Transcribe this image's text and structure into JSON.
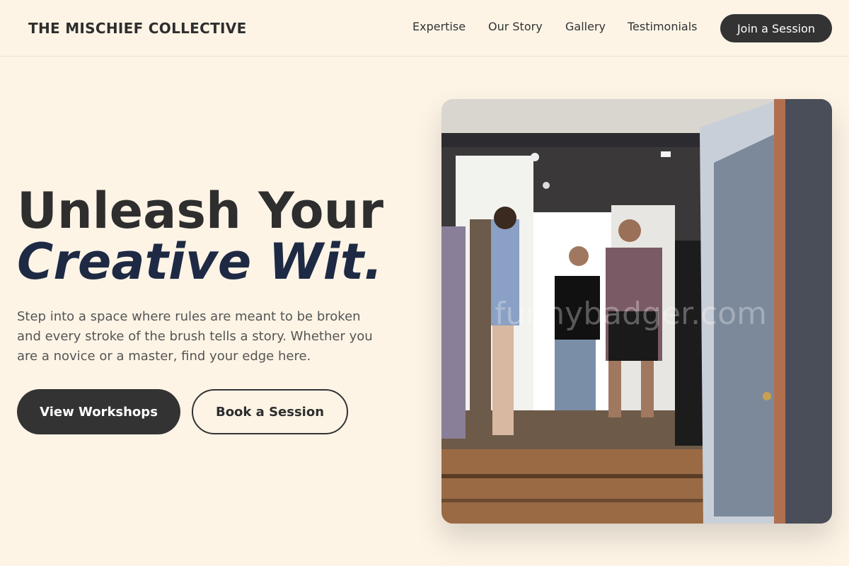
{
  "header": {
    "brand": "THE MISCHIEF COLLECTIVE",
    "nav": [
      "Expertise",
      "Our Story",
      "Gallery",
      "Testimonials"
    ],
    "cta": "Join a Session"
  },
  "hero": {
    "title_line1": "Unleash Your",
    "title_line2": "Creative Wit.",
    "subtitle": "Step into a space where rules are meant to be broken and every stroke of the brush tells a story. Whether you are a novice or a master, find your edge here.",
    "primary_button": "View Workshops",
    "secondary_button": "Book a Session",
    "image_watermark": "funnybadger.com"
  },
  "colors": {
    "background": "#fdf4e6",
    "dark": "#333333",
    "accent": "#1e2a44"
  }
}
